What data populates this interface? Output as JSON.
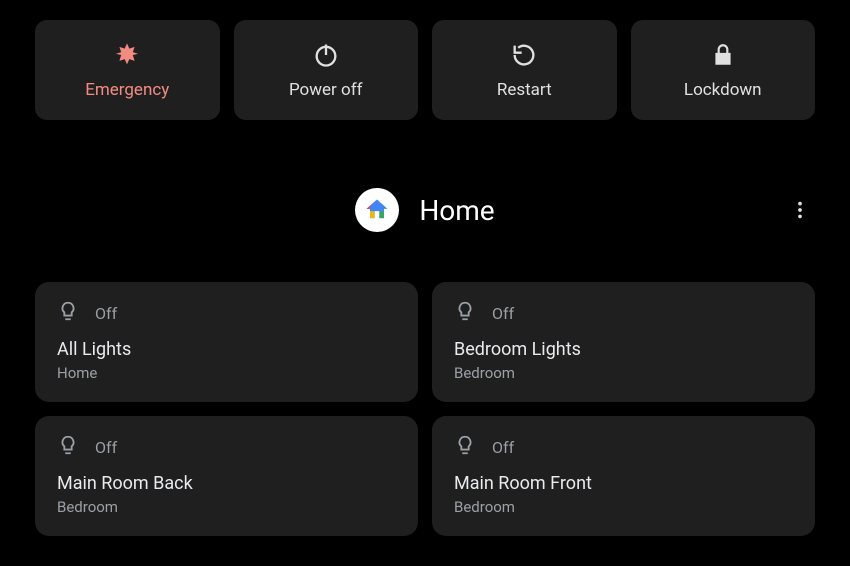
{
  "power_menu": {
    "emergency": {
      "label": "Emergency"
    },
    "power_off": {
      "label": "Power off"
    },
    "restart": {
      "label": "Restart"
    },
    "lockdown": {
      "label": "Lockdown"
    }
  },
  "home_header": {
    "title": "Home"
  },
  "devices": [
    {
      "state": "Off",
      "name": "All Lights",
      "room": "Home"
    },
    {
      "state": "Off",
      "name": "Bedroom Lights",
      "room": "Bedroom"
    },
    {
      "state": "Off",
      "name": "Main Room Back",
      "room": "Bedroom"
    },
    {
      "state": "Off",
      "name": "Main Room Front",
      "room": "Bedroom"
    }
  ]
}
